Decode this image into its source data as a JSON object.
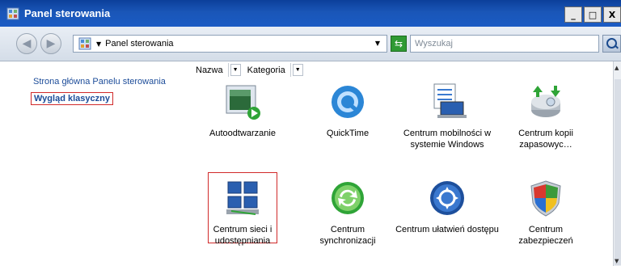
{
  "window": {
    "title": "Panel sterowania",
    "buttons": {
      "minimize": "_",
      "maximize": "□",
      "close": "X"
    }
  },
  "toolbar": {
    "back_icon": "back-icon",
    "forward_icon": "forward-icon",
    "address_crumb": "Panel sterowania",
    "search_placeholder": "Wyszukaj"
  },
  "sidebar": {
    "home_link": "Strona główna Panelu sterowania",
    "classic_view": "Wygląd klasyczny"
  },
  "columns": [
    {
      "label": "Nazwa"
    },
    {
      "label": "Kategoria"
    }
  ],
  "items": [
    {
      "label": "Autoodtwarzanie",
      "icon": "autoplay-icon"
    },
    {
      "label": "QuickTime",
      "icon": "quicktime-icon"
    },
    {
      "label": "Centrum mobilności w systemie Windows",
      "icon": "mobility-center-icon"
    },
    {
      "label": "Centrum kopii zapasowyc…",
      "icon": "backup-center-icon"
    },
    {
      "label": "Centrum sieci i udostępniania",
      "icon": "network-center-icon"
    },
    {
      "label": "Centrum synchronizacji",
      "icon": "sync-center-icon"
    },
    {
      "label": "Centrum ułatwień dostępu",
      "icon": "ease-of-access-icon"
    },
    {
      "label": "Centrum zabezpieczeń",
      "icon": "security-center-icon"
    }
  ],
  "colors": {
    "title_bar": "#1a56b8",
    "link": "#1c4c99",
    "highlight": "#d12a2a"
  }
}
